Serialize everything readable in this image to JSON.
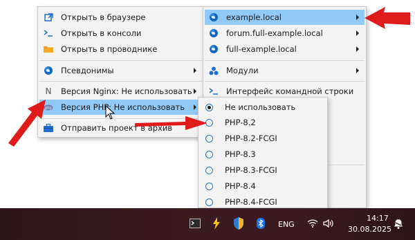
{
  "menu_main": {
    "items": [
      {
        "label": "Открыть в браузере",
        "icon": "external-link-icon"
      },
      {
        "label": "Открыть в консоли",
        "icon": "terminal-icon"
      },
      {
        "label": "Открыть в проводнике",
        "icon": "folder-icon"
      },
      {
        "label": "Псевдонимы",
        "icon": "globe-icon"
      },
      {
        "label": "Версия Nginx: Не использовать",
        "icon": "nginx-n-icon"
      },
      {
        "label": "Версия PHP: Не использовать",
        "icon": "php-icon"
      },
      {
        "label": "Отправить проект в архив",
        "icon": "briefcase-icon"
      }
    ]
  },
  "menu_sites": {
    "items": [
      {
        "label": "example.local",
        "icon": "globe-icon"
      },
      {
        "label": "forum.full-example.local",
        "icon": "globe-icon"
      },
      {
        "label": "full-example.local",
        "icon": "globe-icon"
      },
      {
        "label": "Модули",
        "icon": "modules-icon"
      },
      {
        "label": "Интерфейс командной строки",
        "icon": "terminal-icon"
      }
    ]
  },
  "menu_php": {
    "items": [
      {
        "label": "Не использовать",
        "selected": true
      },
      {
        "label": "PHP-8.2",
        "selected": false
      },
      {
        "label": "PHP-8.2-FCGI",
        "selected": false
      },
      {
        "label": "PHP-8.3",
        "selected": false
      },
      {
        "label": "PHP-8.3-FCGI",
        "selected": false
      },
      {
        "label": "PHP-8.4",
        "selected": false
      },
      {
        "label": "PHP-8.4-FCGI",
        "selected": false
      }
    ]
  },
  "taskbar": {
    "language": "ENG",
    "time": "14:17",
    "date": "30.08.2025"
  },
  "colors": {
    "highlight": "#91c9f7",
    "annotation_arrow": "#e01b1b",
    "taskbar": "#3a1a20"
  }
}
